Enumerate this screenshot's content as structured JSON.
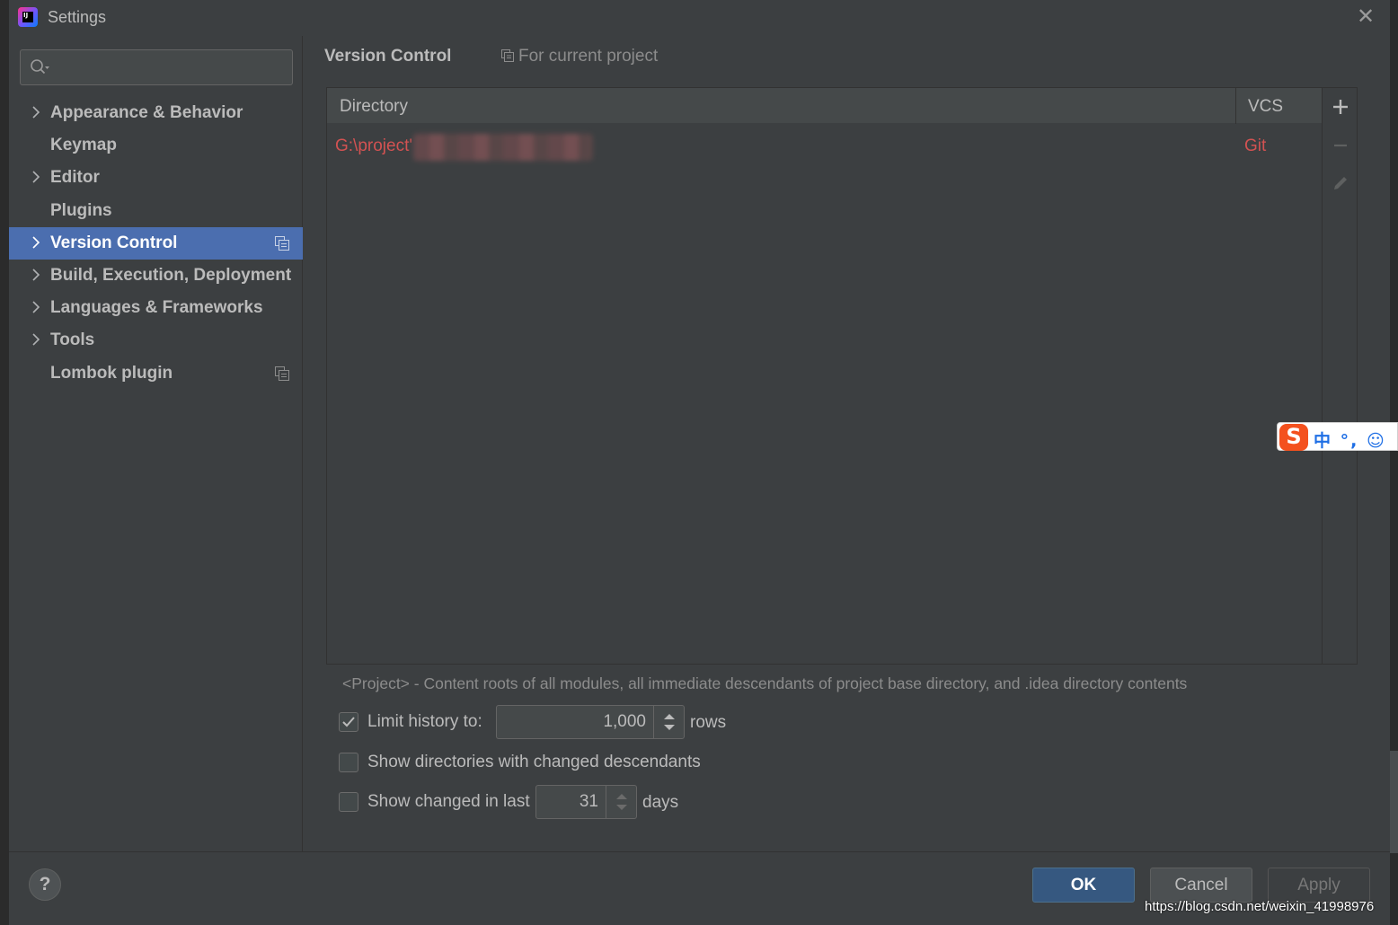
{
  "window": {
    "title": "Settings"
  },
  "search": {
    "placeholder": "",
    "value": ""
  },
  "sidebar": {
    "items": [
      {
        "label": "Appearance & Behavior",
        "expandable": true,
        "selected": false,
        "project_icon": false
      },
      {
        "label": "Keymap",
        "expandable": false,
        "selected": false,
        "project_icon": false
      },
      {
        "label": "Editor",
        "expandable": true,
        "selected": false,
        "project_icon": false
      },
      {
        "label": "Plugins",
        "expandable": false,
        "selected": false,
        "project_icon": false
      },
      {
        "label": "Version Control",
        "expandable": true,
        "selected": true,
        "project_icon": true
      },
      {
        "label": "Build, Execution, Deployment",
        "expandable": true,
        "selected": false,
        "project_icon": false
      },
      {
        "label": "Languages & Frameworks",
        "expandable": true,
        "selected": false,
        "project_icon": false
      },
      {
        "label": "Tools",
        "expandable": true,
        "selected": false,
        "project_icon": false
      },
      {
        "label": "Lombok plugin",
        "expandable": false,
        "selected": false,
        "project_icon": true
      }
    ]
  },
  "content": {
    "breadcrumb": "Version Control",
    "scope_label": "For current project",
    "table": {
      "columns": [
        "Directory",
        "VCS"
      ],
      "rows": [
        {
          "directory": "G:\\project'",
          "vcs": "Git"
        }
      ]
    },
    "hint": "<Project> - Content roots of all modules, all immediate descendants of project base directory, and .idea directory contents",
    "options": {
      "limit_history": {
        "checked": true,
        "label": "Limit history to:",
        "value": "1,000",
        "unit": "rows"
      },
      "show_dirs_changed": {
        "checked": false,
        "label": "Show directories with changed descendants"
      },
      "show_changed_last": {
        "checked": false,
        "label": "Show changed in last",
        "value": "31",
        "unit": "days"
      }
    }
  },
  "footer": {
    "help_label": "?",
    "ok_label": "OK",
    "cancel_label": "Cancel",
    "apply_label": "Apply"
  },
  "ime": {
    "logo": "S",
    "text": "中 °, ☺"
  },
  "watermark": "https://blog.csdn.net/weixin_41998976",
  "colors": {
    "accent": "#4b6eaf",
    "vcs_red": "#d25252",
    "ok_blue": "#365880",
    "bg": "#3c3f41"
  }
}
